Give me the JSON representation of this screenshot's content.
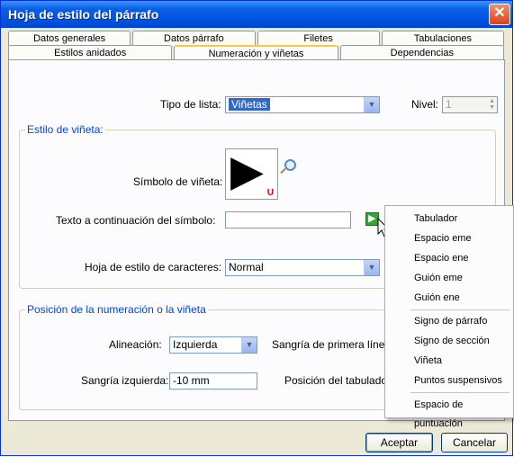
{
  "window": {
    "title": "Hoja de estilo del párrafo",
    "close": "✕"
  },
  "tabs_back": [
    "Datos generales",
    "Datos párrafo",
    "Filetes",
    "Tabulaciones"
  ],
  "tabs_front": [
    "Estilos anidados",
    "Numeración y viñetas",
    "Dependencias"
  ],
  "active_tab": "Numeración y viñetas",
  "list_type": {
    "label": "Tipo de lista:",
    "value": "Viñetas"
  },
  "level": {
    "label": "Nivel:",
    "value": "1"
  },
  "bullet_style": {
    "title": "Estilo de viñeta:",
    "symbol_label": "Símbolo de viñeta:",
    "symbol_glyph": "▶",
    "symbol_subscript": "U",
    "text_after_label": "Texto a continuación del símbolo:",
    "text_after_value": "",
    "char_style_label": "Hoja de estilo de caracteres:",
    "char_style_value": "Normal"
  },
  "position": {
    "title": "Posición de la numeración o la viñeta",
    "alignment_label": "Alineación:",
    "alignment_value": "Izquierda",
    "first_line_label": "Sangría de primera línea",
    "left_indent_label": "Sangría izquierda:",
    "left_indent_value": "-10 mm",
    "tab_position_label": "Posición del tabulador"
  },
  "buttons": {
    "ok": "Aceptar",
    "cancel": "Cancelar"
  },
  "menu_items": [
    "Tabulador",
    "Espacio eme",
    "Espacio ene",
    "Guión eme",
    "Guión ene",
    "Signo de párrafo",
    "Signo de sección",
    "Viñeta",
    "Puntos suspensivos",
    "Espacio de puntuación"
  ],
  "colors": {
    "titlebar": "#0054e3",
    "accent_tab": "#ffc83c",
    "group_title": "#0046d5",
    "selection": "#316ac5",
    "insert_button": "#3aa13a"
  }
}
